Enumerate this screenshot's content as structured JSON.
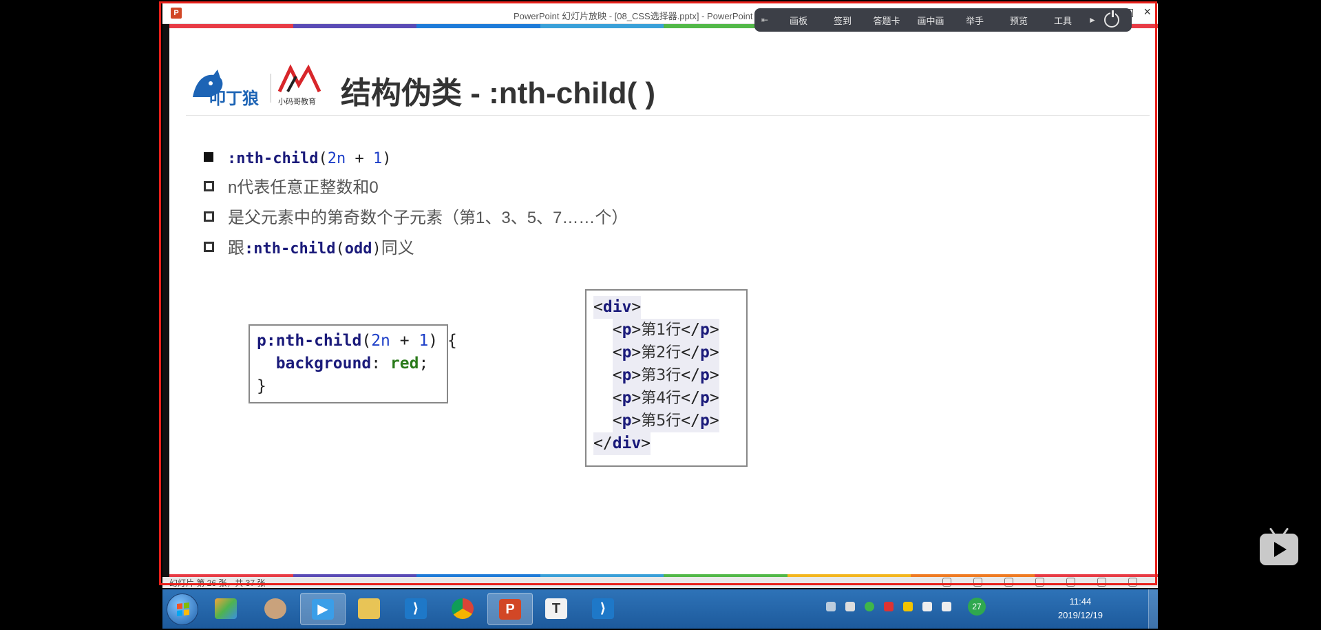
{
  "titlebar": {
    "app_icon": "P",
    "title": "PowerPoint 幻灯片放映 - [08_CSS选择器.pptx] - PowerPoint"
  },
  "class_toolbar": {
    "items": [
      "画板",
      "签到",
      "答题卡",
      "画中画",
      "举手",
      "预览",
      "工具"
    ]
  },
  "stripe_colors": [
    "#e83b45",
    "#5a4bb5",
    "#1e7bd8",
    "#3aa0d8",
    "#52b848",
    "#f3b61f",
    "#ef7b23",
    "#e83b45"
  ],
  "slide": {
    "logo_left_text": "叩丁狼",
    "logo_right_caption": "小码哥教育",
    "title": "结构伪类 - :nth-child( )",
    "bullets": [
      {
        "parts": [
          ":nth-child",
          "(",
          "2n",
          " + ",
          "1",
          ")"
        ]
      },
      {
        "text": "n代表任意正整数和0"
      },
      {
        "text": "是父元素中的第奇数个子元素（第1、3、5、7……个）"
      },
      {
        "parts": [
          "跟",
          ":nth-child",
          "(",
          "odd",
          ")",
          "同义"
        ]
      }
    ],
    "css_code": {
      "selector": "p:nth-child",
      "arg_open": "(",
      "arg_num1": "2n",
      "arg_plus": " + ",
      "arg_num2": "1",
      "arg_close": ") {",
      "property": "background",
      "colon": ": ",
      "value": "red",
      "semicolon": ";",
      "close": "}"
    },
    "html_code": {
      "open_div": "div",
      "rows": [
        {
          "tag": "p",
          "text": "第1行"
        },
        {
          "tag": "p",
          "text": "第2行"
        },
        {
          "tag": "p",
          "text": "第3行"
        },
        {
          "tag": "p",
          "text": "第4行"
        },
        {
          "tag": "p",
          "text": "第5行"
        }
      ],
      "close_div": "div"
    }
  },
  "statusbar": {
    "text": "幻灯片 第 26 张，共 37 张"
  },
  "taskbar": {
    "tray_badge": "27",
    "time": "11:44",
    "date": "2019/12/19"
  }
}
